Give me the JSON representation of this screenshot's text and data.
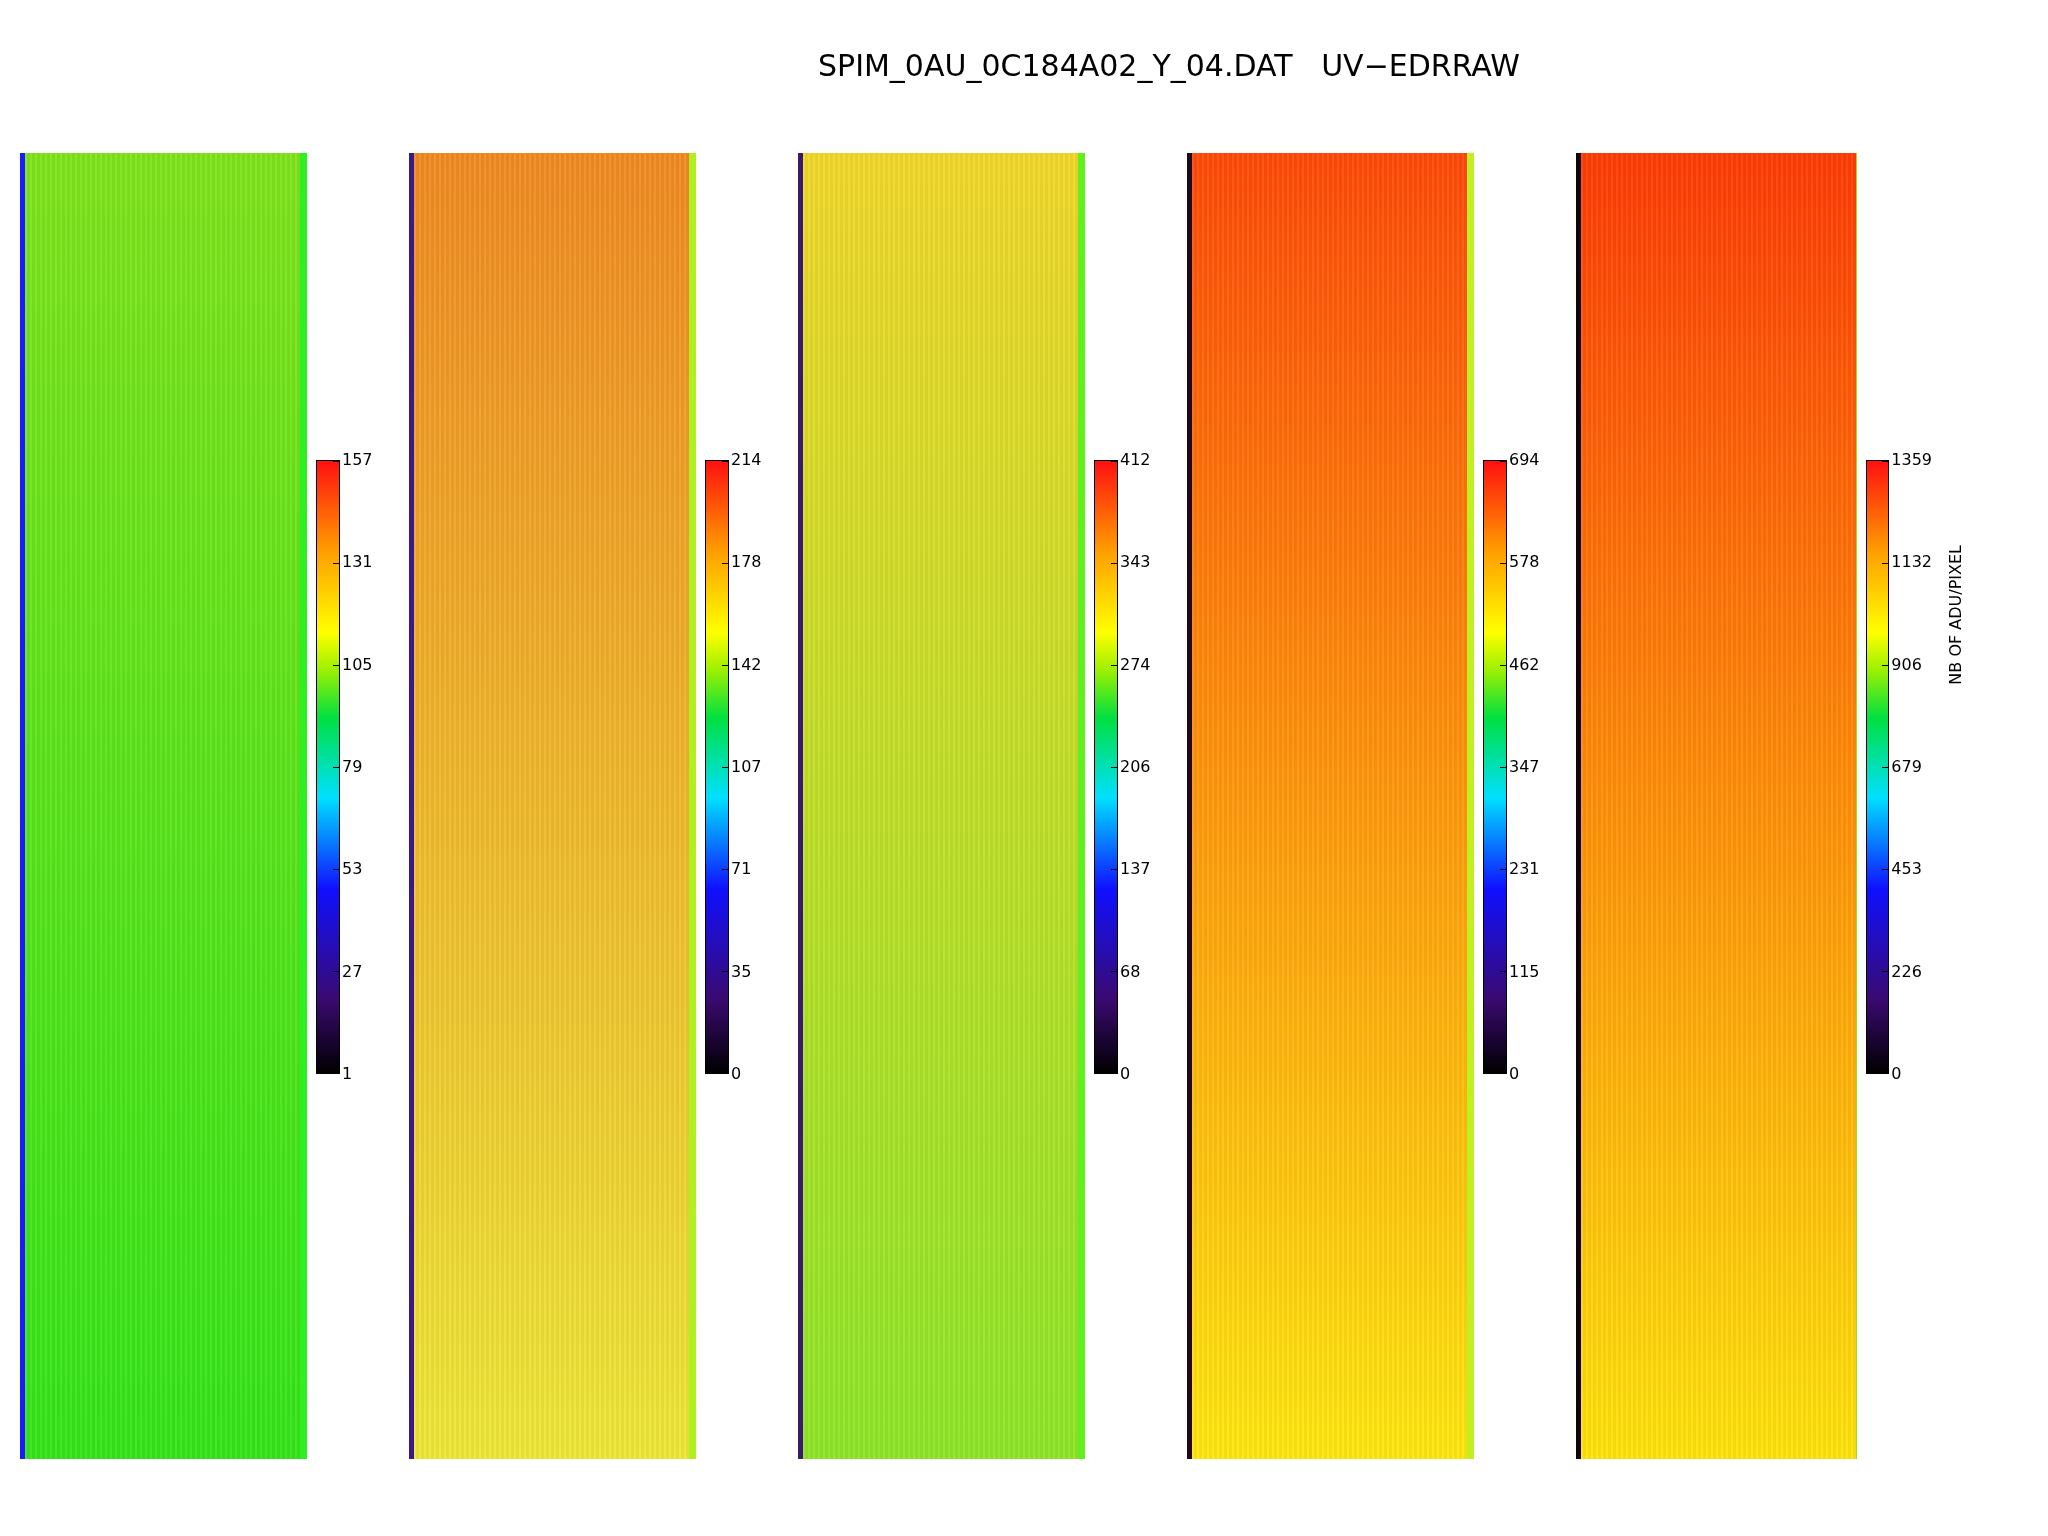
{
  "title": "SPIM_0AU_0C184A02_Y_04.DAT   UV−EDRRAW",
  "panels": [
    {
      "colorbar": {
        "ticks": [
          "157",
          "131",
          "105",
          "79",
          "53",
          "27",
          "1"
        ]
      }
    },
    {
      "colorbar": {
        "ticks": [
          "214",
          "178",
          "142",
          "107",
          "71",
          "35",
          "0"
        ]
      }
    },
    {
      "colorbar": {
        "ticks": [
          "412",
          "343",
          "274",
          "206",
          "137",
          "68",
          "0"
        ]
      }
    },
    {
      "colorbar": {
        "ticks": [
          "694",
          "578",
          "462",
          "347",
          "231",
          "115",
          "0"
        ]
      }
    },
    {
      "colorbar": {
        "ticks": [
          "1359",
          "1132",
          "906",
          "679",
          "453",
          "226",
          "0"
        ],
        "label": "NB OF ADU/PIXEL"
      }
    }
  ]
}
